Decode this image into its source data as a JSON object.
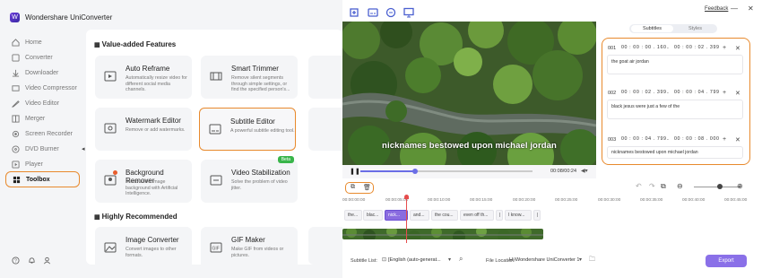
{
  "app": {
    "title": "Wondershare UniConverter",
    "logo_glyph": "W"
  },
  "sidebar": {
    "items": [
      {
        "label": "Home",
        "icon": "home-icon"
      },
      {
        "label": "Converter",
        "icon": "converter-icon"
      },
      {
        "label": "Downloader",
        "icon": "downloader-icon"
      },
      {
        "label": "Video Compressor",
        "icon": "compressor-icon"
      },
      {
        "label": "Video Editor",
        "icon": "editor-icon"
      },
      {
        "label": "Merger",
        "icon": "merger-icon"
      },
      {
        "label": "Screen Recorder",
        "icon": "recorder-icon"
      },
      {
        "label": "DVD Burner",
        "icon": "dvd-icon"
      },
      {
        "label": "Player",
        "icon": "player-icon"
      },
      {
        "label": "Toolbox",
        "icon": "toolbox-icon",
        "active": true
      }
    ]
  },
  "sections": {
    "value_added": "Value-added Features",
    "highly_recommended": "Highly Recommended"
  },
  "cards": {
    "auto_reframe": {
      "title": "Auto Reframe",
      "desc": "Automatically resize video for different social media channels."
    },
    "smart_trimmer": {
      "title": "Smart Trimmer",
      "desc": "Remove silent segments through simple settings, or find the specified person's..."
    },
    "watermark_editor": {
      "title": "Watermark Editor",
      "desc": "Remove or add watermarks."
    },
    "subtitle_editor": {
      "title": "Subtitle Editor",
      "desc": "A powerful subtitle editing tool."
    },
    "background_remover": {
      "title": "Background Remover",
      "desc": "Remove the image background with Artificial Intelligence."
    },
    "video_stabilization": {
      "title": "Video Stabilization",
      "desc": "Solve the problem of video jitter.",
      "badge": "Beta"
    },
    "image_converter": {
      "title": "Image Converter",
      "desc": "Convert images to other formats."
    },
    "gif_maker": {
      "title": "GIF Maker",
      "desc": "Make GIF from videos or pictures."
    }
  },
  "editor": {
    "feedback": "Feedback",
    "caption": "nicknames bestowed upon michael jordan",
    "time_display": "00:08/00:24",
    "progress": 0.32,
    "tabs": {
      "subtitles": "Subtitles",
      "styles": "Styles"
    },
    "subtitles": [
      {
        "num": "001",
        "start": "00 : 00 : 00 . 160",
        "end": "00 : 00 : 02 . 399",
        "text": "the goat air jordan"
      },
      {
        "num": "002",
        "start": "00 : 00 : 02 . 399",
        "end": "00 : 00 : 04 . 799",
        "text": "black jesus were just a few of the"
      },
      {
        "num": "003",
        "start": "00 : 00 : 04 . 799",
        "end": "00 : 00 : 08 . 000",
        "text": "nicknames bestowed upon michael jordan"
      }
    ],
    "ruler": [
      "00:00:00:00",
      "00:00:05:00",
      "00:00:10:00",
      "00:00:15:00",
      "00:00:20:00",
      "00:00:25:00",
      "00:00:30:00",
      "00:00:35:00",
      "00:00:40:00",
      "00:00:45:00"
    ],
    "segments": [
      "the...",
      "blac...",
      "nick...",
      "and...",
      "the cou...",
      "even off th...",
      "|",
      "I know...",
      "|"
    ],
    "subtitle_list_label": "Subtitle List:",
    "subtitle_list_value": "[English (auto-generat...",
    "file_location_label": "File Location:",
    "file_location_value": "H:\\Wondershare UniConverter 1",
    "export": "Export"
  }
}
